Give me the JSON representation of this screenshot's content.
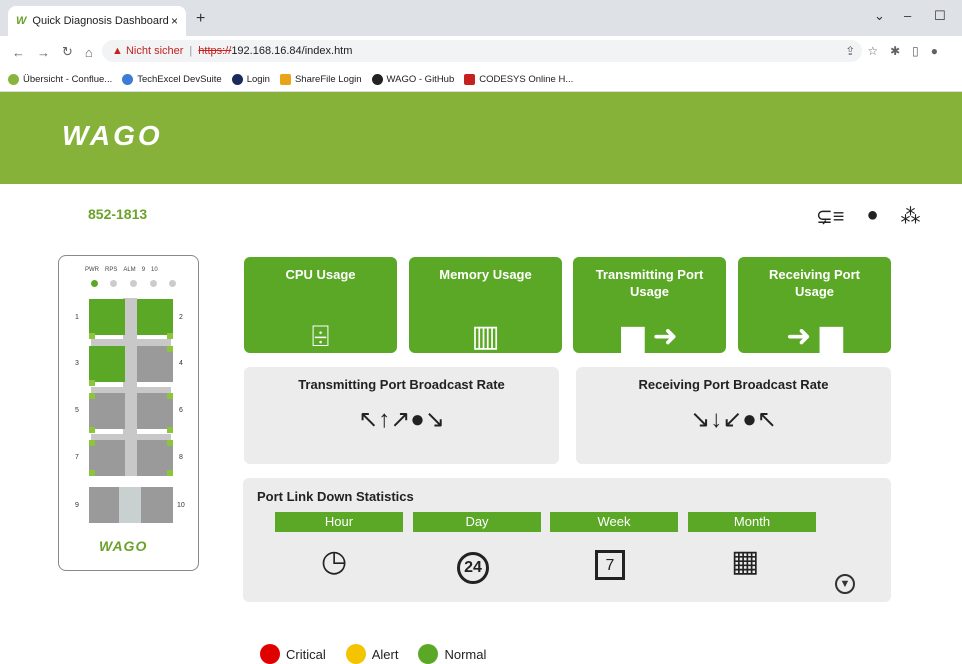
{
  "browser": {
    "tab_title": "Quick Diagnosis Dashboard",
    "tab_favicon": "W",
    "tab_close": "×",
    "new_tab": "+",
    "security_warning": "Nicht sicher",
    "url_scheme": "https://",
    "url_rest": "192.168.16.84/index.htm",
    "bookmarks": [
      {
        "label": "Übersicht - Conflue...",
        "color": "#8ab53d"
      },
      {
        "label": "TechExcel DevSuite",
        "color": "#3d7bd5"
      },
      {
        "label": "Login",
        "color": "#1b2a5c"
      },
      {
        "label": "ShareFile Login",
        "color": "#e8a317"
      },
      {
        "label": "WAGO - GitHub",
        "color": "#222222"
      },
      {
        "label": "CODESYS Online H...",
        "color": "#c5221f"
      }
    ]
  },
  "header": {
    "logo": "WAGO",
    "banner_color": "#86b23a"
  },
  "device": {
    "model": "852-1813",
    "led_labels": [
      "PWR",
      "RPS",
      "ALM",
      "9",
      "10"
    ],
    "led_states": [
      "green",
      "gray",
      "gray",
      "gray",
      "gray"
    ],
    "port_numbers": [
      "1",
      "2",
      "3",
      "4",
      "5",
      "6",
      "7",
      "8",
      "9",
      "10"
    ],
    "port_states": [
      "on",
      "on",
      "on",
      "off",
      "off",
      "off",
      "off",
      "off",
      "off",
      "off"
    ],
    "logo": "WAGO"
  },
  "tiles": {
    "cpu": {
      "label": "CPU Usage",
      "icon": "cpu-chip-icon"
    },
    "memory": {
      "label": "Memory Usage",
      "icon": "memory-module-icon"
    },
    "tx_usage": {
      "label": "Transmitting Port Usage",
      "icon": "ethernet-port-transmit-icon"
    },
    "rx_usage": {
      "label": "Receiving Port Usage",
      "icon": "ethernet-port-receive-icon"
    },
    "tx_broadcast": {
      "label": "Transmitting Port Broadcast Rate",
      "icon": "broadcast-out-icon"
    },
    "rx_broadcast": {
      "label": "Receiving Port Broadcast Rate",
      "icon": "broadcast-in-icon"
    }
  },
  "link_down": {
    "title": "Port Link Down Statistics",
    "periods": [
      "Hour",
      "Day",
      "Week",
      "Month"
    ],
    "icon_day_text": "24",
    "icon_week_text": "7"
  },
  "legend": [
    {
      "label": "Critical",
      "color": "#e00000"
    },
    {
      "label": "Alert",
      "color": "#f5c400"
    },
    {
      "label": "Normal",
      "color": "#5ba826"
    }
  ],
  "accent": "#5ba826"
}
